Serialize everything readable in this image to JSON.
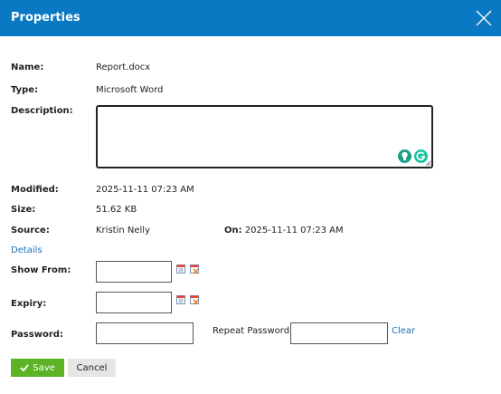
{
  "dialog": {
    "title": "Properties"
  },
  "fields": {
    "name_label": "Name:",
    "name_value": "Report.docx",
    "type_label": "Type:",
    "type_value": "Microsoft Word",
    "description_label": "Description:",
    "modified_label": "Modified:",
    "modified_value": "2025-11-11 07:23 AM",
    "size_label": "Size:",
    "size_value": "51.62 KB",
    "source_label": "Source:",
    "source_value": "Kristin Nelly",
    "on_label": "On:",
    "on_value": "2025-11-11 07:23 AM",
    "details_link": "Details",
    "show_from_label": "Show From:",
    "expiry_label": "Expiry:",
    "password_label": "Password:",
    "repeat_password_label": "Repeat Password:",
    "clear_link": "Clear"
  },
  "buttons": {
    "save": "Save",
    "cancel": "Cancel"
  },
  "icons": {
    "close": "close-icon",
    "calendar": "calendar-icon",
    "calendar_clear": "calendar-clear-icon",
    "bulb": "lightbulb-icon",
    "grammarly": "grammarly-icon",
    "check": "check-icon"
  },
  "colors": {
    "header": "#0a79c4",
    "save": "#5cb325",
    "link": "#1a6fb5"
  }
}
